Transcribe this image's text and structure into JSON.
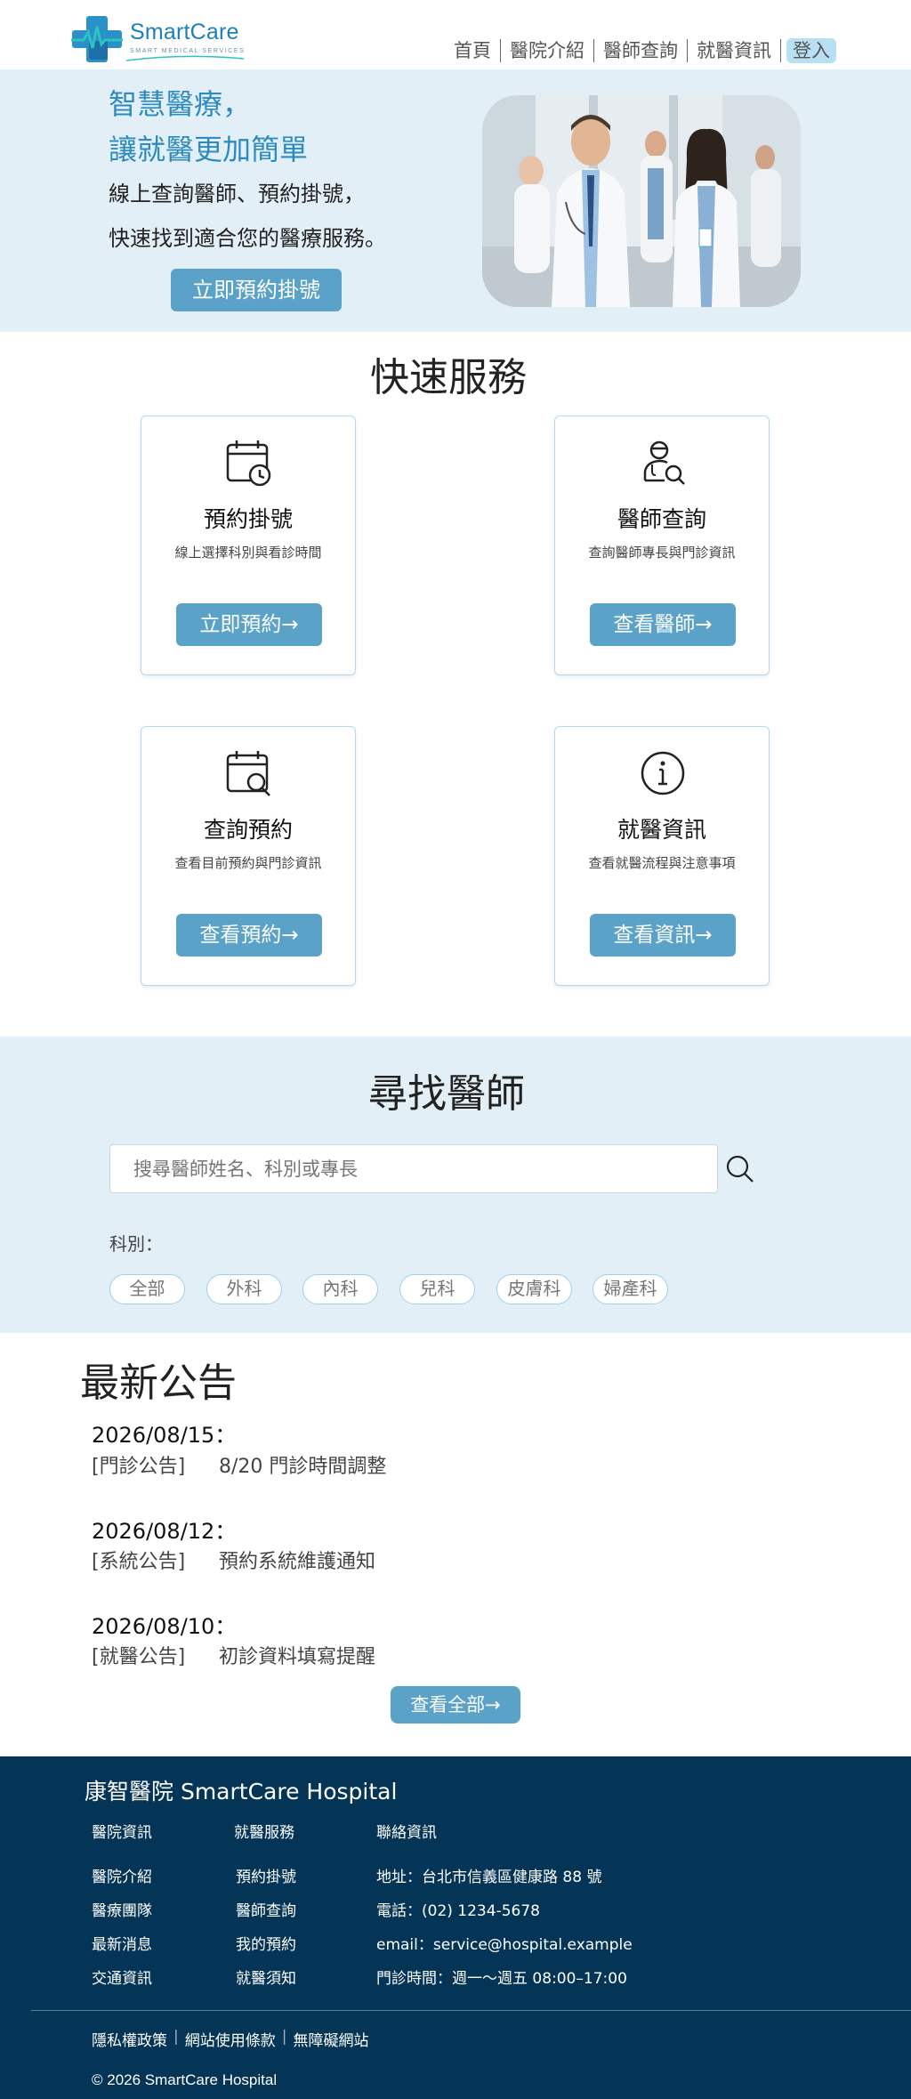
{
  "brand": {
    "name": "SmartCare",
    "tagline": "SMART MEDICAL SERVICES",
    "primary_color": "#1e7fb8",
    "accent_color": "#5ba2c8",
    "footer_color": "#043556"
  },
  "nav": {
    "items": [
      "首頁",
      "醫院介紹",
      "醫師查詢",
      "就醫資訊"
    ],
    "login": "登入"
  },
  "hero": {
    "title_line1": "智慧醫療，",
    "title_line2": "讓就醫更加簡單",
    "subtitle_line1": "線上查詢醫師、預約掛號，",
    "subtitle_line2": "快速找到適合您的醫療服務。",
    "cta": "立即預約掛號",
    "image_icon": "doctors-photo"
  },
  "quick_services": {
    "title": "快速服務",
    "cards": [
      {
        "title": "預約掛號",
        "desc": "線上選擇科別與看診時間",
        "button": "立即預約→",
        "icon": "calendar-clock-icon"
      },
      {
        "title": "醫師查詢",
        "desc": "查詢醫師專長與門診資訊",
        "button": "查看醫師→",
        "icon": "doctor-search-icon"
      },
      {
        "title": "查詢預約",
        "desc": "查看目前預約與門診資訊",
        "button": "查看預約→",
        "icon": "calendar-search-icon"
      },
      {
        "title": "就醫資訊",
        "desc": "查看就醫流程與注意事項",
        "button": "查看資訊→",
        "icon": "info-icon"
      }
    ]
  },
  "doctor_search": {
    "title": "尋找醫師",
    "placeholder": "搜尋醫師姓名、科別或專長",
    "dept_label": "科別：",
    "departments": [
      "全部",
      "外科",
      "內科",
      "兒科",
      "皮膚科",
      "婦產科"
    ]
  },
  "announcements": {
    "title": "最新公告",
    "items": [
      {
        "date": "2026/08/15：",
        "tag": "[門診公告]",
        "text": "8/20 門診時間調整"
      },
      {
        "date": "2026/08/12：",
        "tag": "[系統公告]",
        "text": "預約系統維護通知"
      },
      {
        "date": "2026/08/10：",
        "tag": "[就醫公告]",
        "text": "初診資料填寫提醒"
      }
    ],
    "view_all": "查看全部→"
  },
  "footer": {
    "title": "康智醫院 SmartCare Hospital",
    "col1": {
      "heading": "醫院資訊",
      "links": [
        "醫院介紹",
        "醫療團隊",
        "最新消息",
        "交通資訊"
      ]
    },
    "col2": {
      "heading": "就醫服務",
      "links": [
        "預約掛號",
        "醫師查詢",
        "我的預約",
        "就醫須知"
      ]
    },
    "col3": {
      "heading": "聯絡資訊",
      "lines": [
        "地址：台北市信義區健康路 88 號",
        "電話：(02) 1234-5678",
        "email：service@hospital.example",
        "門診時間：週一～週五 08:00–17:00"
      ]
    },
    "legal": [
      "隱私權政策",
      "網站使用條款",
      "無障礙網站"
    ],
    "copyright": "© 2026 SmartCare Hospital"
  }
}
